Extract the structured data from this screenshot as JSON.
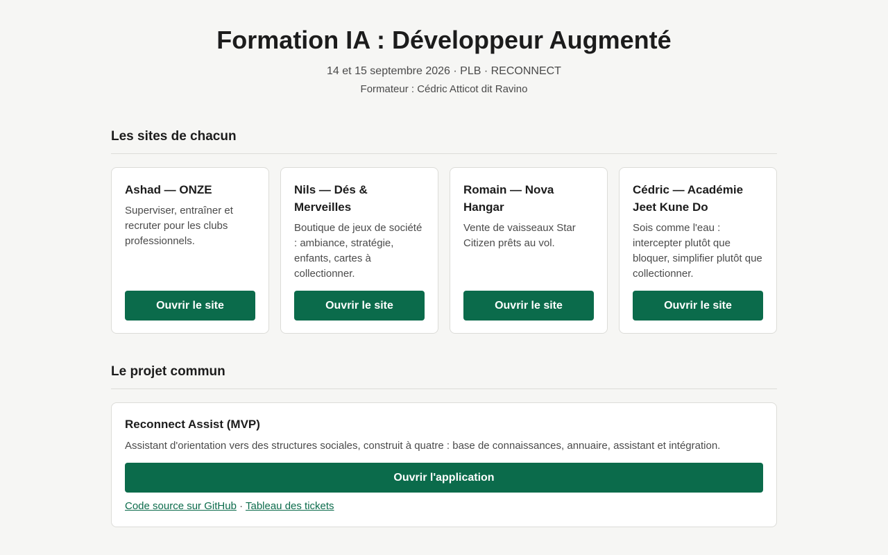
{
  "header": {
    "title": "Formation IA : Développeur Augmenté",
    "meta": "14 et 15 septembre 2026 · PLB · RECONNECT",
    "trainer": "Formateur : Cédric Atticot dit Ravino"
  },
  "sites_section": {
    "title": "Les sites de chacun",
    "cards": [
      {
        "title": "Ashad — ONZE",
        "description": "Superviser, entraîner et recruter pour les clubs professionnels.",
        "button": "Ouvrir le site"
      },
      {
        "title": "Nils — Dés & Merveilles",
        "description": "Boutique de jeux de société : ambiance, stratégie, enfants, cartes à collectionner.",
        "button": "Ouvrir le site"
      },
      {
        "title": "Romain — Nova Hangar",
        "description": "Vente de vaisseaux Star Citizen prêts au vol.",
        "button": "Ouvrir le site"
      },
      {
        "title": "Cédric — Académie Jeet Kune Do",
        "description": "Sois comme l'eau : intercepter plutôt que bloquer, simplifier plutôt que collectionner.",
        "button": "Ouvrir le site"
      }
    ]
  },
  "project_section": {
    "title": "Le projet commun",
    "project": {
      "title": "Reconnect Assist (MVP)",
      "description": "Assistant d'orientation vers des structures sociales, construit à quatre : base de connaissances, annuaire, assistant et intégration.",
      "button": "Ouvrir l'application",
      "link_github": "Code source sur GitHub",
      "separator": "·",
      "link_tickets": "Tableau des tickets"
    }
  },
  "colors": {
    "accent": "#0b6b4b",
    "background": "#f6f6f4",
    "card": "#ffffff"
  }
}
